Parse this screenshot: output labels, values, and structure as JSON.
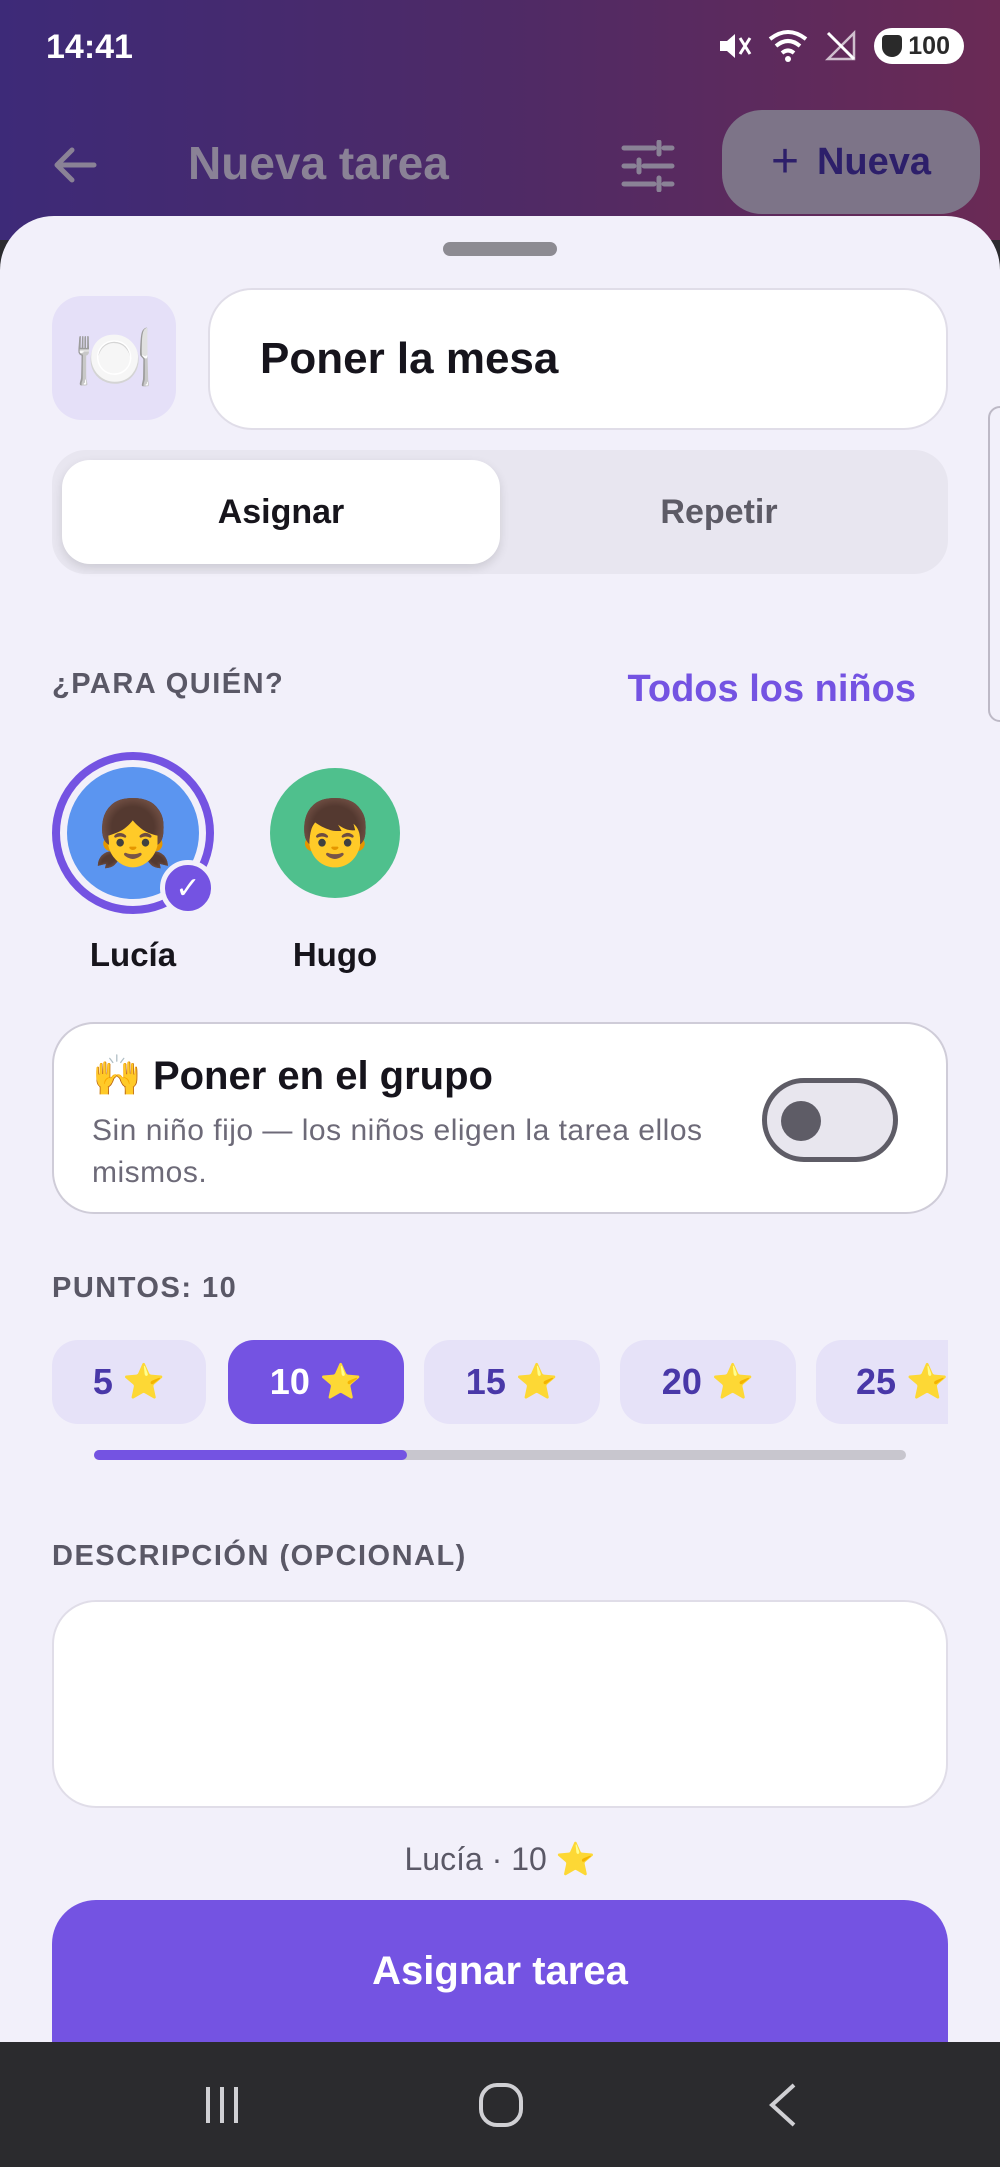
{
  "status_bar": {
    "time": "14:41",
    "battery": "100",
    "icons": [
      "mute-icon",
      "wifi-icon",
      "no-signal-icon",
      "battery-shield-icon"
    ]
  },
  "toolbar": {
    "title": "Nueva tarea",
    "new_button_plus": "+",
    "new_button_label": "Nueva",
    "icons": [
      "back-arrow-icon",
      "filter-sliders-icon"
    ]
  },
  "task": {
    "icon": "🍽️",
    "title": "Poner la mesa"
  },
  "tabs": {
    "assign": "Asignar",
    "repeat": "Repetir",
    "active": "assign"
  },
  "for_whom": {
    "label": "¿PARA QUIÉN?",
    "all_kids_link": "Todos los niños",
    "kids": [
      {
        "name": "Lucía",
        "emoji": "👧",
        "color": "#5b95f0",
        "selected": true
      },
      {
        "name": "Hugo",
        "emoji": "👦",
        "color": "#4fc08d",
        "selected": false
      }
    ]
  },
  "group": {
    "emoji": "🙌",
    "title": "Poner en el grupo",
    "subtitle": "Sin niño fijo — los niños eligen la tarea ellos mismos.",
    "enabled": false
  },
  "points": {
    "label": "PUNTOS: 10",
    "star": "⭐",
    "options": [
      {
        "value": "5",
        "selected": false
      },
      {
        "value": "10",
        "selected": true
      },
      {
        "value": "15",
        "selected": false
      },
      {
        "value": "20",
        "selected": false
      },
      {
        "value": "25",
        "selected": false
      }
    ],
    "scroll_progress": 0.385
  },
  "description": {
    "label": "DESCRIPCIÓN (OPCIONAL)",
    "value": ""
  },
  "summary": "Lucía · 10 ⭐",
  "assign_button": "Asignar tarea",
  "colors": {
    "accent": "#7453e2",
    "sheet_bg": "#f2f0fa"
  }
}
